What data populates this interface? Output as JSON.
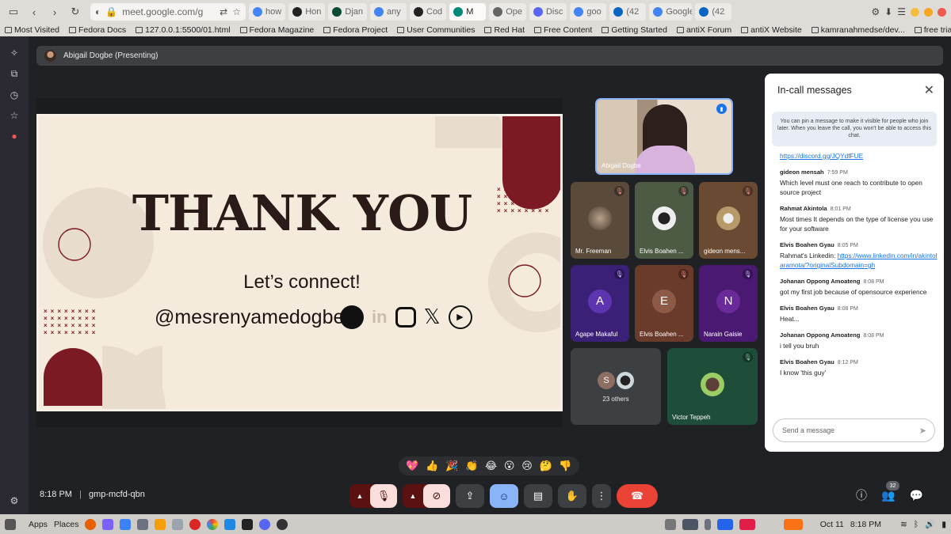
{
  "browser": {
    "url": "meet.google.com/g",
    "tabs": [
      {
        "label": "how",
        "color": "#4285f4"
      },
      {
        "label": "Hon",
        "color": "#222"
      },
      {
        "label": "Djan",
        "color": "#0c4b33"
      },
      {
        "label": "any",
        "color": "#4285f4"
      },
      {
        "label": "Cod",
        "color": "#222"
      },
      {
        "label": "M",
        "color": "#00897b",
        "active": true
      },
      {
        "label": "Ope",
        "color": "#666"
      },
      {
        "label": "Disc",
        "color": "#5865f2"
      },
      {
        "label": "goo",
        "color": "#4285f4"
      },
      {
        "label": "(42",
        "color": "#0a66c2"
      },
      {
        "label": "Google",
        "color": "#4285f4"
      },
      {
        "label": "(42",
        "color": "#0a66c2"
      }
    ],
    "bookmarks": [
      "Most Visited",
      "Fedora Docs",
      "127.0.0.1:5500/01.html",
      "Fedora Magazine",
      "Fedora Project",
      "User Communities",
      "Red Hat",
      "Free Content",
      "Getting Started",
      "antiX Forum",
      "antiX Website",
      "kamranahmedse/dev...",
      "free trial payroll"
    ]
  },
  "meet": {
    "presenter_label": "Abigail Dogbe (Presenting)",
    "slide": {
      "title": "THANK YOU",
      "subtitle": "Let’s connect!",
      "handle": "@mesrenyamedogbe"
    },
    "tiles": [
      {
        "name": "Abigail Dogbe"
      },
      {
        "name": "Mr. Freeman"
      },
      {
        "name": "Elvis Boahen ..."
      },
      {
        "name": "gideon mens..."
      },
      {
        "name": "Agape Makaful",
        "letter": "A"
      },
      {
        "name": "Elvis Boahen ...",
        "letter": "E"
      },
      {
        "name": "Narain Gaisie",
        "letter": "N"
      },
      {
        "name": "23 others",
        "letter": "S"
      },
      {
        "name": "Victor Teppeh"
      }
    ],
    "chat": {
      "title": "In-call messages",
      "pin_note": "You can pin a message to make it visible for people who join later. When you leave the call, you won't be able to access this chat.",
      "first_link": "https://discord.gg/JQYdfFUE",
      "messages": [
        {
          "sender": "gideon mensah",
          "time": "7:59 PM",
          "text": "Which level must one reach to contribute to open source project"
        },
        {
          "sender": "Rahmat Akintola",
          "time": "8:01 PM",
          "text": "Most times It depends on the type of license you use for your software"
        },
        {
          "sender": "Elvis Boahen Gyau",
          "time": "8:05 PM",
          "text": "Rahmat's Linkedin: ",
          "link": "https://www.linkedin.com/in/akintolaramota/?originalSubdomain=gh"
        },
        {
          "sender": "Johanan Oppong Amoateng",
          "time": "8:08 PM",
          "text": "got my first job because of opensource experience"
        },
        {
          "sender": "Elvis Boahen Gyau",
          "time": "8:08 PM",
          "text": "Heat..."
        },
        {
          "sender": "Johanan Oppong Amoateng",
          "time": "8:08 PM",
          "text": "i tell you bruh"
        },
        {
          "sender": "Elvis Boahen Gyau",
          "time": "8:12 PM",
          "text": "I know 'this guy'"
        }
      ],
      "input_placeholder": "Send a message"
    },
    "reactions": [
      "💖",
      "👍",
      "🎉",
      "👏",
      "😂",
      "😮",
      "😢",
      "🤔",
      "👎"
    ],
    "time": "8:18 PM",
    "meeting_code": "gmp-mcfd-qbn",
    "participant_count": "32"
  },
  "taskbar": {
    "apps_label": "Apps",
    "places_label": "Places",
    "date": "Oct 11",
    "time": "8:18 PM"
  }
}
